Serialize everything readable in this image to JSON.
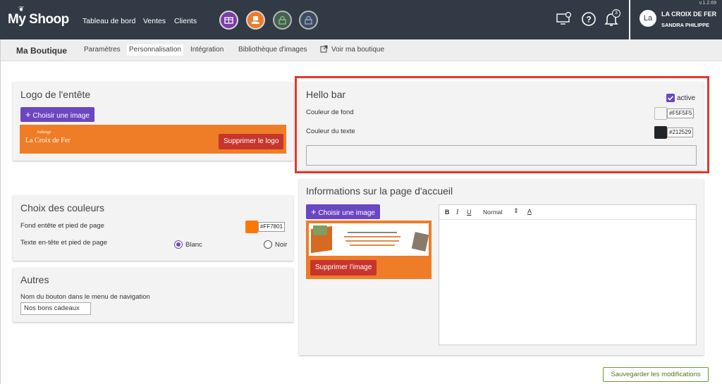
{
  "app": {
    "logo": "My Shoop",
    "version": "v.1.2.69"
  },
  "topnav": [
    {
      "label": "Tableau de bord"
    },
    {
      "label": "Ventes"
    },
    {
      "label": "Clients"
    }
  ],
  "toolbar_icons": [
    "gift-card-icon",
    "hand-gift-icon",
    "lock-icon",
    "lock-icon",
    "monitor-settings-icon",
    "help-icon",
    "bell-icon"
  ],
  "notifications": {
    "count": "3"
  },
  "user": {
    "initials": "La",
    "shop": "LA CROIX DE FER",
    "name": "SANDRA PHILIPPE"
  },
  "subnav": {
    "title": "Ma Boutique",
    "tabs": [
      {
        "label": "Paramètres"
      },
      {
        "label": "Personnalisation"
      },
      {
        "label": "Intégration"
      },
      {
        "label": "Bibliothèque d'images"
      },
      {
        "label": "Voir ma boutique"
      }
    ]
  },
  "logo_card": {
    "title": "Logo de l'entête",
    "choose_label": "Choisir une image",
    "preview_small": "Auberge",
    "preview_name": "La Croix de Fer",
    "delete_label": "Supprimer le logo"
  },
  "colors_card": {
    "title": "Choix des couleurs",
    "bg_label": "Fond entête et pied de page",
    "bg_hex": "#FF7801",
    "text_label": "Texte en-tête et pied de page",
    "option_white": "Blanc",
    "option_black": "Noir"
  },
  "other_card": {
    "title": "Autres",
    "nav_label": "Nom du bouton dans le menu de navigation",
    "nav_value": "Nos bons cadeaux"
  },
  "hello_bar": {
    "title": "Hello bar",
    "active_label": "active",
    "bg_label": "Couleur de fond",
    "bg_hex": "#F5F5F5",
    "text_label": "Couleur du texte",
    "text_hex": "#212529"
  },
  "home_card": {
    "title": "Informations sur la page d'accueil",
    "choose_label": "Choisir une image",
    "delete_label": "Supprimer l'image",
    "editor": {
      "bold": "B",
      "italic": "I",
      "underline": "U",
      "format": "Normal",
      "color": "A"
    }
  },
  "save_label": "Sauvegarder les modifications",
  "colors": {
    "topbar": "#323a45",
    "accent": "#6b46c1",
    "orange": "#ff7801",
    "danger": "#c7352c",
    "save": "#6a9c2f"
  }
}
